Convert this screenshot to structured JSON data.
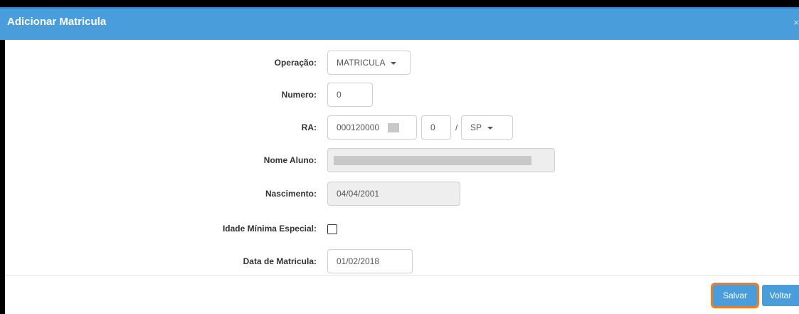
{
  "modal": {
    "title": "Adicionar Matricula",
    "close_symbol": "×"
  },
  "form": {
    "operacao": {
      "label": "Operação:",
      "value": "MATRICULA"
    },
    "numero": {
      "label": "Numero:",
      "value": "0"
    },
    "ra": {
      "label": "RA:",
      "value": "000120000",
      "digit": "0",
      "separator": "/",
      "uf": "SP"
    },
    "nome_aluno": {
      "label": "Nome Aluno:",
      "value": ""
    },
    "nascimento": {
      "label": "Nascimento:",
      "value": "04/04/2001"
    },
    "idade_minima": {
      "label": "Idade Mínima Especial:",
      "checked": false
    },
    "data_matricula": {
      "label": "Data de Matricula:",
      "value": "01/02/2018"
    }
  },
  "footer": {
    "save_label": "Salvar",
    "back_label": "Voltar"
  },
  "colors": {
    "header": "#4a9ddb",
    "button": "#4a9ddb",
    "highlight": "#f07c1f"
  }
}
